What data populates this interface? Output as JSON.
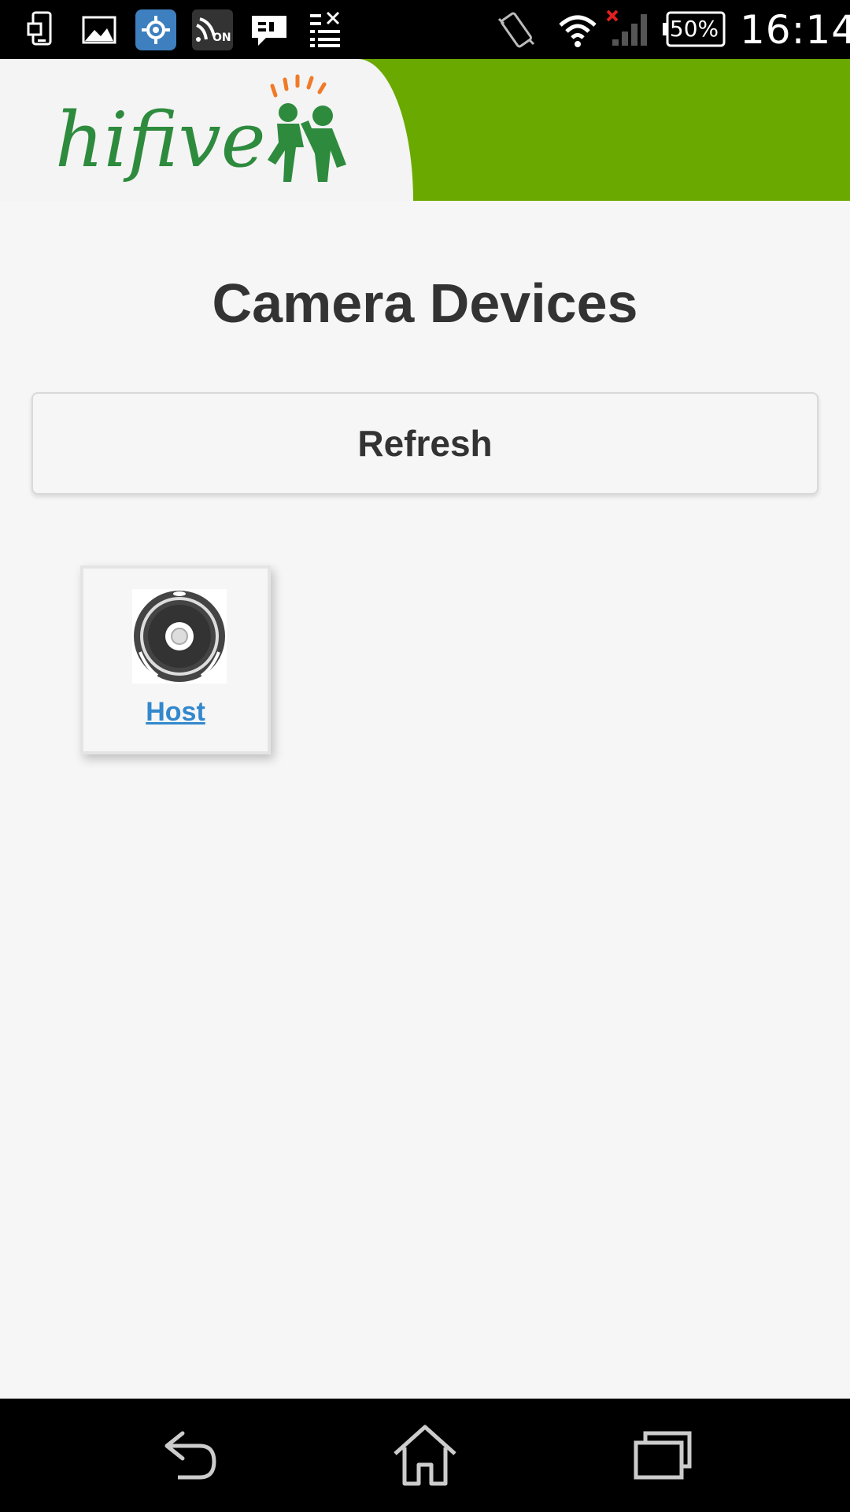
{
  "status_bar": {
    "icons": [
      "phone-transfer-icon",
      "image-icon",
      "settings-gear-icon",
      "nfc-on-icon",
      "message-icon",
      "clear-list-icon",
      "vibrate-icon",
      "wifi-icon",
      "no-signal-icon"
    ],
    "nfc_label": "ON",
    "battery": "50%",
    "time": "16:14"
  },
  "header": {
    "logo_text": "hifive",
    "colors": {
      "brand_green": "#6aaa00",
      "logo_green": "#2e8b3e",
      "logo_orange": "#f07a28"
    }
  },
  "main": {
    "title": "Camera Devices",
    "refresh_label": "Refresh",
    "devices": [
      {
        "name": "Host",
        "icon": "robot-camera-icon"
      }
    ],
    "colors": {
      "link": "#3388cc",
      "text": "#333333"
    }
  },
  "nav_bar": {
    "buttons": [
      "back-icon",
      "home-icon",
      "recent-apps-icon"
    ]
  }
}
